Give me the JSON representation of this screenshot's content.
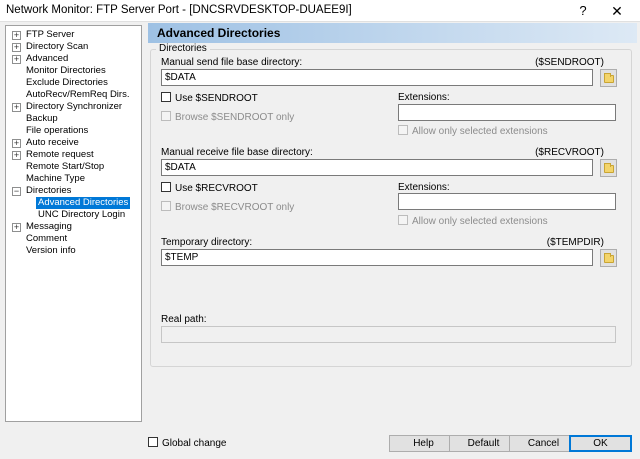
{
  "window": {
    "title": "Network Monitor: FTP Server Port - [DNCSRVDESKTOP-DUAEE9I]",
    "help_glyph": "?",
    "close_glyph": "✕"
  },
  "tree": {
    "items": [
      {
        "label": "FTP Server",
        "expander": "+"
      },
      {
        "label": "Directory Scan",
        "expander": "+"
      },
      {
        "label": "Advanced",
        "expander": "+"
      },
      {
        "label": "Monitor Directories",
        "expander": ""
      },
      {
        "label": "Exclude Directories",
        "expander": ""
      },
      {
        "label": "AutoRecv/RemReq Dirs.",
        "expander": ""
      },
      {
        "label": "Directory Synchronizer",
        "expander": "+"
      },
      {
        "label": "Backup",
        "expander": ""
      },
      {
        "label": "File operations",
        "expander": ""
      },
      {
        "label": "Auto receive",
        "expander": "+"
      },
      {
        "label": "Remote request",
        "expander": "+"
      },
      {
        "label": "Remote Start/Stop",
        "expander": ""
      },
      {
        "label": "Machine Type",
        "expander": ""
      },
      {
        "label": "Directories",
        "expander": "−"
      },
      {
        "label": "Advanced Directories",
        "expander": "",
        "selected": true
      },
      {
        "label": "UNC Directory Login",
        "expander": ""
      },
      {
        "label": "Messaging",
        "expander": "+"
      },
      {
        "label": "Comment",
        "expander": ""
      },
      {
        "label": "Version info",
        "expander": ""
      }
    ]
  },
  "page": {
    "title": "Advanced Directories",
    "group_label": "Directories",
    "send": {
      "label": "Manual send file base directory:",
      "var": "($SENDROOT)",
      "value": "$DATA",
      "use_label": "Use $SENDROOT",
      "browse_label": "Browse $SENDROOT only",
      "ext_label": "Extensions:",
      "ext_value": "",
      "allow_label": "Allow only selected extensions"
    },
    "recv": {
      "label": "Manual receive file base directory:",
      "var": "($RECVROOT)",
      "value": "$DATA",
      "use_label": "Use $RECVROOT",
      "browse_label": "Browse $RECVROOT only",
      "ext_label": "Extensions:",
      "ext_value": "",
      "allow_label": "Allow only selected extensions"
    },
    "temp": {
      "label": "Temporary directory:",
      "var": "($TEMPDIR)",
      "value": "$TEMP"
    },
    "real_path": {
      "label": "Real path:",
      "value": ""
    }
  },
  "footer": {
    "global_change": "Global change",
    "help": "Help",
    "default": "Default",
    "cancel": "Cancel",
    "ok": "OK"
  }
}
